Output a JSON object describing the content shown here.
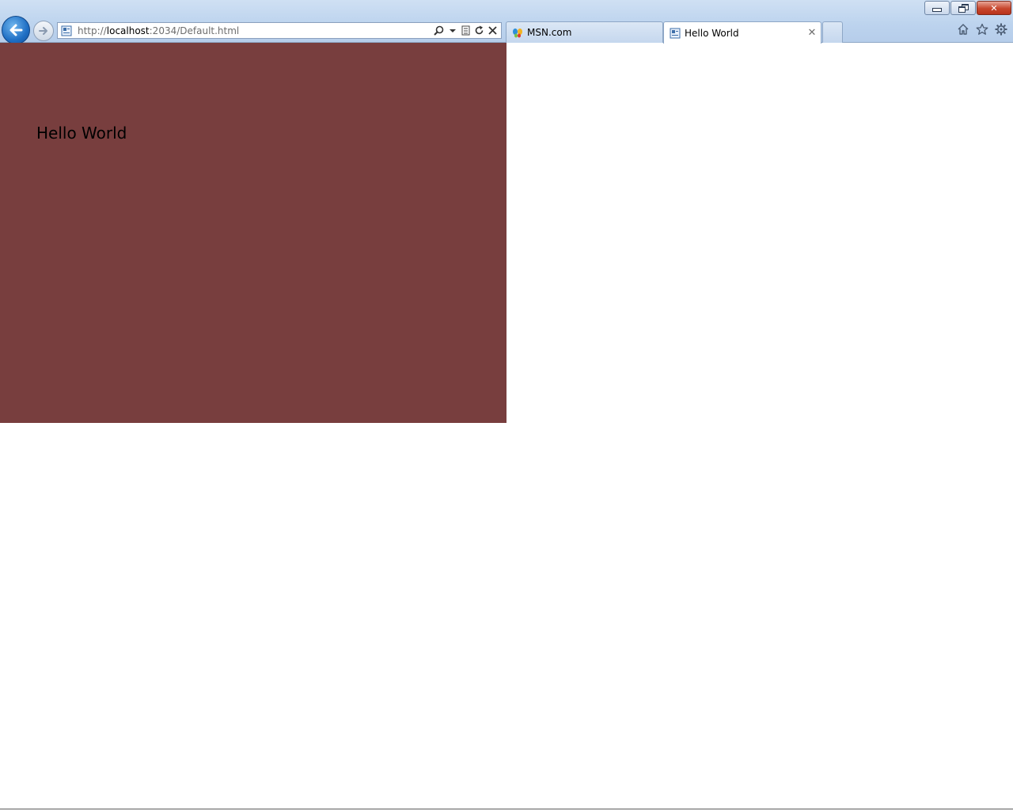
{
  "browser": {
    "address": {
      "scheme": "http://",
      "host": "localhost",
      "path": ":2034/Default.html"
    },
    "tabs": [
      {
        "label": "MSN.com",
        "icon": "msn-butterfly-icon",
        "active": false
      },
      {
        "label": "Hello World",
        "icon": "page-icon",
        "active": true
      }
    ],
    "window_controls": [
      "minimize",
      "restore",
      "close"
    ],
    "toolbar_icons": [
      "home-icon",
      "favorites-star-icon",
      "gear-icon"
    ]
  },
  "page": {
    "heading": "Hello World",
    "panel_color": "#783E3E"
  },
  "colors": {
    "chrome": "#BCD3EE",
    "close_button": "#C7462D",
    "back_button": "#1F6FC4"
  }
}
